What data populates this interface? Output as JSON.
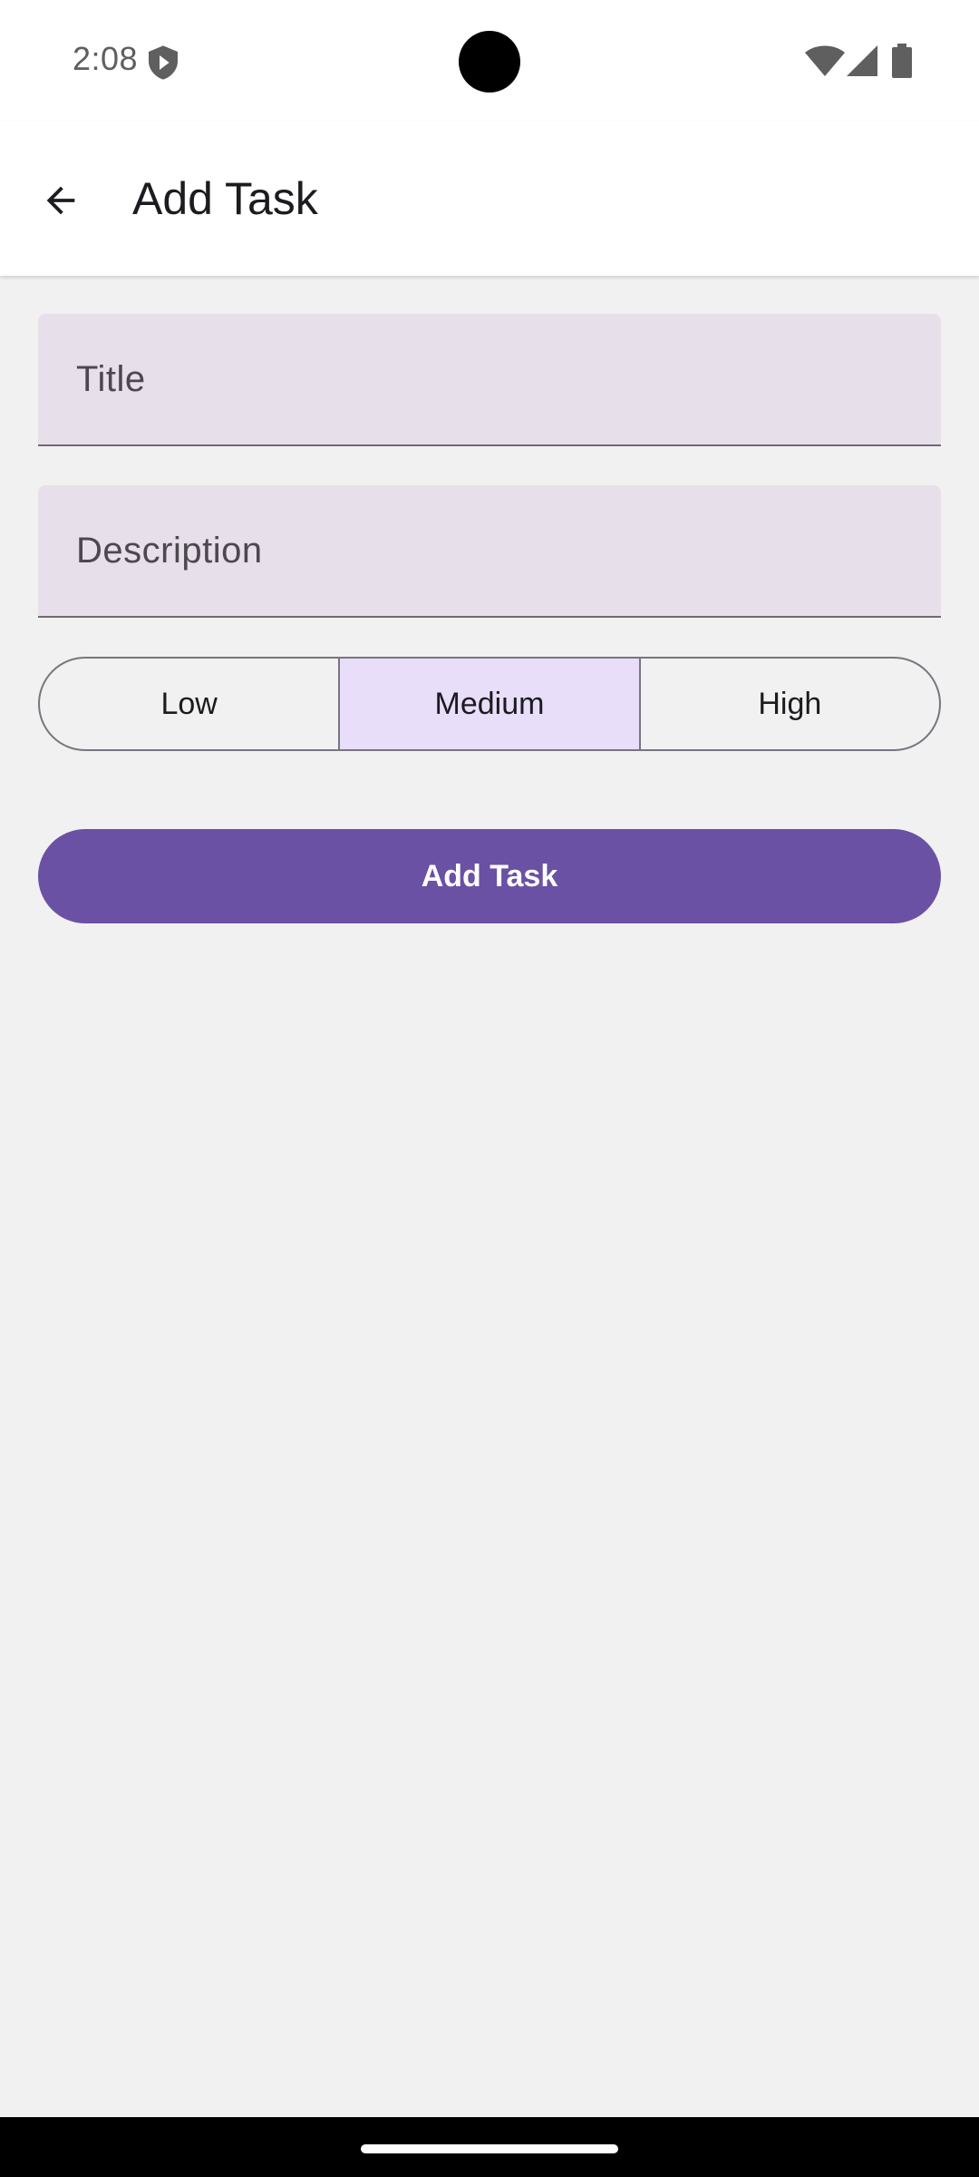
{
  "status_bar": {
    "time": "2:08"
  },
  "app_bar": {
    "title": "Add Task"
  },
  "form": {
    "title_placeholder": "Title",
    "title_value": "",
    "description_placeholder": "Description",
    "description_value": "",
    "priority_options": [
      "Low",
      "Medium",
      "High"
    ],
    "selected_priority": "Medium",
    "submit_label": "Add Task"
  },
  "colors": {
    "primary": "#6a51a4",
    "field_background": "#e7dfea",
    "selected_segment": "#e8defa",
    "screen_background": "#f1f1f1"
  },
  "icons": {
    "back": "arrow-back-icon",
    "status": [
      "shield-icon",
      "wifi-icon",
      "signal-icon",
      "battery-icon"
    ]
  }
}
